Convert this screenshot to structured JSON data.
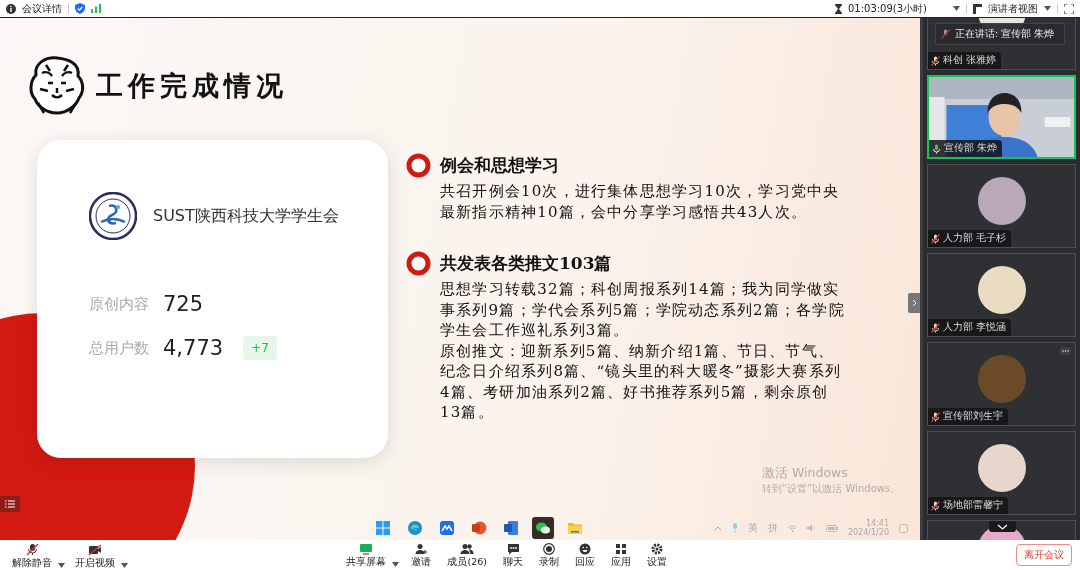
{
  "top_bar": {
    "meeting_info": "会议详情",
    "timer": "01:03:09(3小时)",
    "view": "演讲者视图"
  },
  "slide": {
    "title": "工作完成情况",
    "card": {
      "org_name": "SUST陕西科技大学学生会",
      "stats": [
        {
          "label": "原创内容",
          "value": "725"
        },
        {
          "label": "总用户数",
          "value": "4,773",
          "badge": "+7"
        }
      ]
    },
    "sections": [
      {
        "heading": "例会和思想学习",
        "paragraphs": [
          "共召开例会10次，进行集体思想学习10次，学习党中央最新指示精神10篇，会中分享学习感悟共43人次。"
        ]
      },
      {
        "heading": "共发表各类推文103篇",
        "paragraphs": [
          "思想学习转载32篇；科创周报系列14篇；我为同学做实事系列9篇；学代会系列5篇；学院动态系列2篇；各学院学生会工作巡礼系列3篇。",
          "原创推文：迎新系列5篇、纳新介绍1篇、节日、节气、纪念日介绍系列8篇、“镜头里的科大暖冬”摄影大赛系列4篇、考研加油系列2篇、好书推荐系列5篇，剩余原创13篇。"
        ]
      }
    ],
    "activation_notice": {
      "title": "激活 Windows",
      "subtitle": "转到“设置”以激活 Windows。"
    },
    "taskbar": {
      "apps": [
        {
          "kind": "start",
          "selected": false
        },
        {
          "kind": "browser",
          "selected": false
        },
        {
          "kind": "meeting",
          "selected": false
        },
        {
          "kind": "slides",
          "selected": false
        },
        {
          "kind": "docs",
          "selected": false
        },
        {
          "kind": "chat",
          "selected": true
        },
        {
          "kind": "folder",
          "selected": false
        }
      ],
      "tray": [
        "英",
        "拼"
      ],
      "time": "14:41",
      "date": "2024/1/20"
    }
  },
  "participants": {
    "speaking_banner": "正在讲话:  宣传部 朱烨",
    "tiles": [
      {
        "name": "科创 张雅婷",
        "kind": "avatar",
        "muted": true,
        "speaking": false,
        "show_more": false,
        "color": "#e8e4dc"
      },
      {
        "name": "宣传部 朱烨",
        "kind": "video",
        "muted": false,
        "speaking": true,
        "show_more": false
      },
      {
        "name": "人力部 毛子杉",
        "kind": "avatar",
        "muted": true,
        "speaking": false,
        "show_more": false,
        "color": "#b9a8b8"
      },
      {
        "name": "人力部 李悦涵",
        "kind": "avatar",
        "muted": true,
        "speaking": false,
        "show_more": false,
        "color": "#e9dcc0"
      },
      {
        "name": "宣传部刘生宇",
        "kind": "avatar",
        "muted": true,
        "speaking": false,
        "show_more": true,
        "color": "#6b4a2a"
      },
      {
        "name": "场地部雷馨宁",
        "kind": "avatar",
        "muted": true,
        "speaking": false,
        "show_more": false,
        "color": "#e6d6cc"
      }
    ]
  },
  "toolbar": {
    "left": [
      {
        "kind": "mic_muted",
        "label": "解除静音"
      },
      {
        "kind": "camera_off",
        "label": "开启视频"
      }
    ],
    "center": [
      {
        "kind": "share",
        "label": "共享屏幕"
      },
      {
        "kind": "invite",
        "label": "邀请"
      },
      {
        "kind": "members",
        "label": "成员(26)"
      },
      {
        "kind": "chat",
        "label": "聊天"
      },
      {
        "kind": "record",
        "label": "录制"
      },
      {
        "kind": "react",
        "label": "回应"
      },
      {
        "kind": "apps",
        "label": "应用"
      },
      {
        "kind": "settings",
        "label": "设置"
      }
    ],
    "leave": "离开会议"
  }
}
